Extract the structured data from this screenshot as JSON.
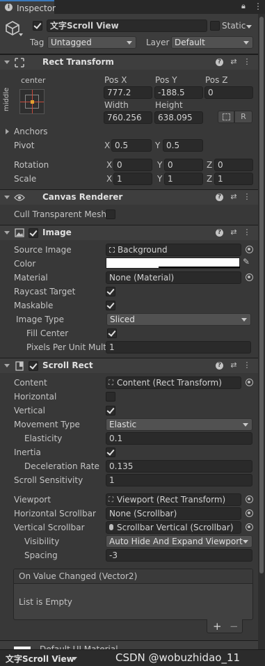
{
  "tab": {
    "title": "Inspector"
  },
  "gameobject": {
    "active": true,
    "name": "文字Scroll View",
    "static_label": "Static",
    "tag_label": "Tag",
    "tag_value": "Untagged",
    "layer_label": "Layer",
    "layer_value": "Default"
  },
  "rect_transform": {
    "title": "Rect Transform",
    "anchor_h": "center",
    "anchor_v": "middle",
    "pos_x_label": "Pos X",
    "pos_x": "777.2",
    "pos_y_label": "Pos Y",
    "pos_y": "-188.5",
    "pos_z_label": "Pos Z",
    "pos_z": "0",
    "width_label": "Width",
    "width": "760.256",
    "height_label": "Height",
    "height": "638.095",
    "r_button": "R",
    "anchors_label": "Anchors",
    "pivot_label": "Pivot",
    "pivot_x": "0.5",
    "pivot_y": "0.5",
    "rotation_label": "Rotation",
    "rot_x": "0",
    "rot_y": "0",
    "rot_z": "0",
    "scale_label": "Scale",
    "scale_x": "1",
    "scale_y": "1",
    "scale_z": "1",
    "x": "X",
    "y": "Y",
    "z": "Z"
  },
  "canvas_renderer": {
    "title": "Canvas Renderer",
    "cull_label": "Cull Transparent Mesh",
    "cull": false
  },
  "image": {
    "title": "Image",
    "enabled": true,
    "source_image_label": "Source Image",
    "source_image": "Background",
    "color_label": "Color",
    "color": "#ffffff",
    "material_label": "Material",
    "material": "None (Material)",
    "raycast_label": "Raycast Target",
    "raycast": true,
    "maskable_label": "Maskable",
    "maskable": true,
    "image_type_label": "Image Type",
    "image_type": "Sliced",
    "fill_center_label": "Fill Center",
    "fill_center": true,
    "ppu_label": "Pixels Per Unit Multip",
    "ppu": "1"
  },
  "scroll_rect": {
    "title": "Scroll Rect",
    "enabled": true,
    "content_label": "Content",
    "content": "Content (Rect Transform)",
    "horizontal_label": "Horizontal",
    "horizontal": false,
    "vertical_label": "Vertical",
    "vertical": true,
    "movement_label": "Movement Type",
    "movement": "Elastic",
    "elasticity_label": "Elasticity",
    "elasticity": "0.1",
    "inertia_label": "Inertia",
    "inertia": true,
    "decel_label": "Deceleration Rate",
    "decel": "0.135",
    "sensitivity_label": "Scroll Sensitivity",
    "sensitivity": "1",
    "viewport_label": "Viewport",
    "viewport": "Viewport (Rect Transform)",
    "hscroll_label": "Horizontal Scrollbar",
    "hscroll": "None (Scrollbar)",
    "vscroll_label": "Vertical Scrollbar",
    "vscroll": "Scrollbar Vertical (Scrollbar)",
    "visibility_label": "Visibility",
    "visibility": "Auto Hide And Expand Viewport",
    "spacing_label": "Spacing",
    "spacing": "-3",
    "event_title": "On Value Changed (Vector2)",
    "event_empty": "List is Empty",
    "add_button": "+",
    "remove_button": "−"
  },
  "next_component": {
    "title": "Default UI Material"
  },
  "bottom": {
    "object_name": "文字Scroll View"
  },
  "watermark": "CSDN @wobuzhidao_11"
}
